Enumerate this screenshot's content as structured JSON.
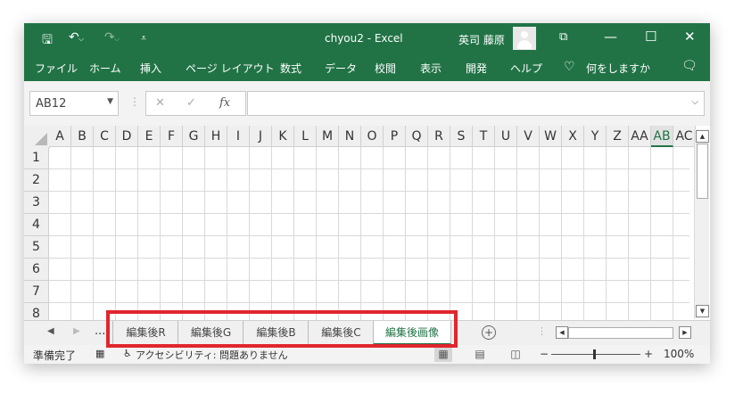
{
  "titlebar": {
    "save_icon": "save-icon",
    "undo_icon": "undo-icon",
    "redo_icon": "redo-icon",
    "customize_icon": "customize-qat-icon",
    "title": "chyou2  -  Excel",
    "user_name": "英司 藤原",
    "accent": "#217346"
  },
  "ribbon": {
    "tabs": [
      "ファイル",
      "ホーム",
      "挿入",
      "ページ レイアウト",
      "数式",
      "データ",
      "校閲",
      "表示",
      "開発",
      "ヘルプ"
    ],
    "tell_me": "何をしますか",
    "lightbulb_icon": "lightbulb-icon",
    "comment_icon": "comment-icon"
  },
  "formula_bar": {
    "name_box": "AB12",
    "cancel": "✕",
    "enter": "✓",
    "fx": "fx",
    "formula": ""
  },
  "grid": {
    "columns": [
      "A",
      "B",
      "C",
      "D",
      "E",
      "F",
      "G",
      "H",
      "I",
      "J",
      "K",
      "L",
      "M",
      "N",
      "O",
      "P",
      "Q",
      "R",
      "S",
      "T",
      "U",
      "V",
      "W",
      "X",
      "Y",
      "Z",
      "AA",
      "AB",
      "AC"
    ],
    "rows": [
      "1",
      "2",
      "3",
      "4",
      "5",
      "6",
      "7",
      "8"
    ],
    "selected_column": "AB"
  },
  "sheets": {
    "ellipsis": "...",
    "tabs": [
      "編集後R",
      "編集後G",
      "編集後B",
      "編集後C",
      "編集後画像"
    ],
    "active": "編集後画像",
    "add": "+"
  },
  "status": {
    "ready": "準備完了",
    "accessibility": "アクセシビリティ: 問題ありません",
    "zoom_minus": "−",
    "zoom_plus": "+",
    "zoom": "100%"
  }
}
